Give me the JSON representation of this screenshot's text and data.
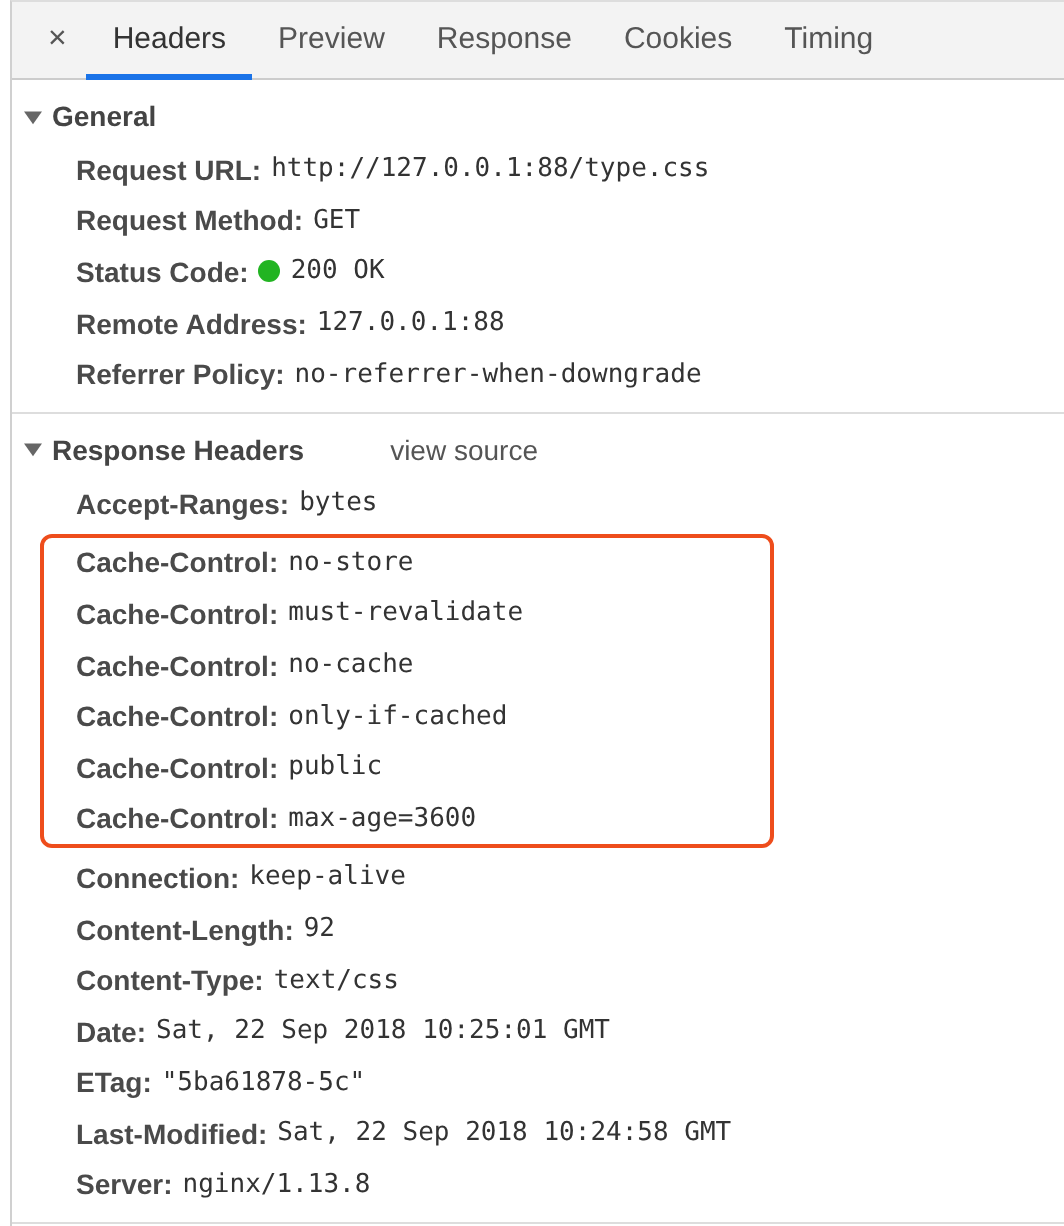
{
  "close_label": "×",
  "tabs": [
    {
      "label": "Headers",
      "selected": true
    },
    {
      "label": "Preview",
      "selected": false
    },
    {
      "label": "Response",
      "selected": false
    },
    {
      "label": "Cookies",
      "selected": false
    },
    {
      "label": "Timing",
      "selected": false
    }
  ],
  "sections": [
    {
      "title": "General",
      "expanded": true,
      "groups": [
        {
          "boxed": false,
          "headers": [
            {
              "name": "Request URL:",
              "value": "http://127.0.0.1:88/type.css"
            },
            {
              "name": "Request Method:",
              "value": "GET"
            },
            {
              "name": "Status Code:",
              "value": "200 OK",
              "color": "#22b422"
            },
            {
              "name": "Remote Address:",
              "value": "127.0.0.1:88"
            },
            {
              "name": "Referrer Policy:",
              "value": "no-referrer-when-downgrade"
            }
          ]
        }
      ]
    },
    {
      "title": "Response Headers",
      "link": "view source",
      "expanded": true,
      "groups": [
        {
          "boxed": false,
          "headers": [
            {
              "name": "Accept-Ranges:",
              "value": "bytes"
            }
          ]
        },
        {
          "boxed": true,
          "headers": [
            {
              "name": "Cache-Control:",
              "value": "no-store"
            },
            {
              "name": "Cache-Control:",
              "value": "must-revalidate"
            },
            {
              "name": "Cache-Control:",
              "value": "no-cache"
            },
            {
              "name": "Cache-Control:",
              "value": "only-if-cached"
            },
            {
              "name": "Cache-Control:",
              "value": "public"
            },
            {
              "name": "Cache-Control:",
              "value": "max-age=3600"
            }
          ]
        },
        {
          "boxed": false,
          "headers": [
            {
              "name": "Connection:",
              "value": "keep-alive"
            },
            {
              "name": "Content-Length:",
              "value": "92"
            },
            {
              "name": "Content-Type:",
              "value": "text/css"
            },
            {
              "name": "Date:",
              "value": "Sat, 22 Sep 2018 10:25:01 GMT"
            },
            {
              "name": "ETag:",
              "value": "\"5ba61878-5c\""
            },
            {
              "name": "Last-Modified:",
              "value": "Sat, 22 Sep 2018 10:24:58 GMT"
            },
            {
              "name": "Server:",
              "value": "nginx/1.13.8"
            }
          ]
        }
      ]
    }
  ]
}
